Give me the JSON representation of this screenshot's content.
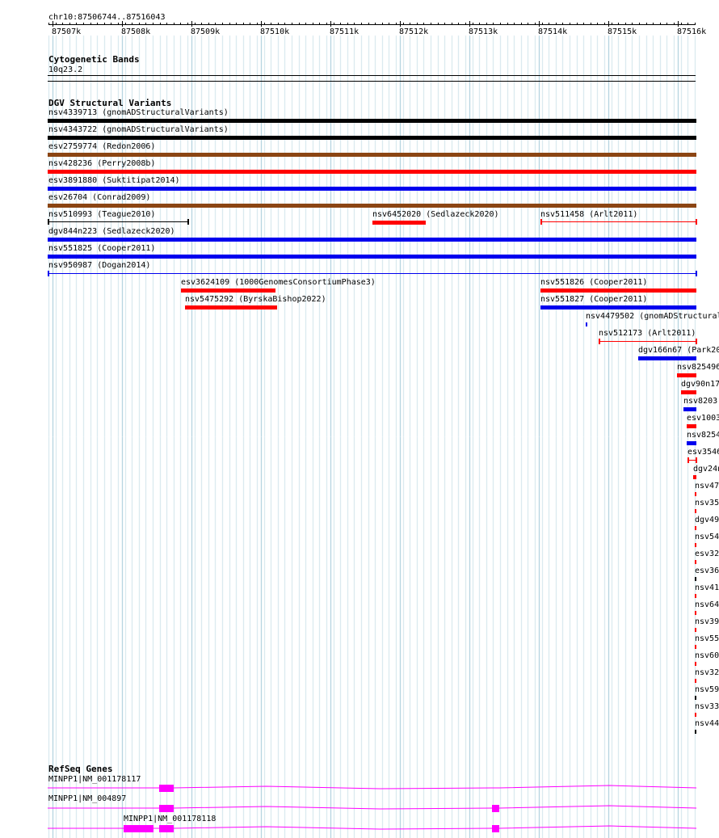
{
  "ruler": {
    "coordinates": "chr10:87506744..87516043",
    "ticks": [
      "87507k",
      "87508k",
      "87509k",
      "87510k",
      "87511k",
      "87512k",
      "87513k",
      "87514k",
      "87515k",
      "87516k"
    ]
  },
  "cytoband": {
    "title": "Cytogenetic Bands",
    "band": "10q23.2"
  },
  "dgv": {
    "title": "DGV Structural Variants",
    "features": [
      {
        "label": "nsv4339713 (gnomADStructuralVariants)",
        "color": "#000000"
      },
      {
        "label": "nsv4343722 (gnomADStructuralVariants)",
        "color": "#000000"
      },
      {
        "label": "esv2759774 (Redon2006)",
        "color": "#8B4513"
      },
      {
        "label": "nsv428236 (Perry2008b)",
        "color": "#FF0000"
      },
      {
        "label": "esv3891880 (Suktitipat2014)",
        "color": "#0000EE"
      },
      {
        "label": "esv26704 (Conrad2009)",
        "color": "#8B4513"
      },
      {
        "label": "nsv510993 (Teague2010)",
        "color": "#000000"
      },
      {
        "label": "nsv6452020 (Sedlazeck2020)",
        "color": "#FF0000"
      },
      {
        "label": "nsv511458 (Arlt2011)",
        "color": "#FF0000"
      },
      {
        "label": "dgv844n223 (Sedlazeck2020)",
        "color": "#0000EE"
      },
      {
        "label": "nsv551825 (Cooper2011)",
        "color": "#0000EE"
      },
      {
        "label": "nsv950987 (Dogan2014)",
        "color": "#0000EE"
      },
      {
        "label": "esv3624109 (1000GenomesConsortiumPhase3)",
        "color": "#FF0000"
      },
      {
        "label": "nsv551826 (Cooper2011)",
        "color": "#FF0000"
      },
      {
        "label": "nsv5475292 (ByrskaBishop2022)",
        "color": "#FF0000"
      },
      {
        "label": "nsv551827 (Cooper2011)",
        "color": "#0000EE"
      },
      {
        "label": "nsv4479502 (gnomADStructural",
        "color": "#0000EE"
      },
      {
        "label": "nsv512173 (Arlt2011)",
        "color": "#FF0000"
      },
      {
        "label": "dgv166n67 (Park20",
        "color": "#0000EE"
      },
      {
        "label": "nsv825496",
        "color": "#FF0000"
      },
      {
        "label": "dgv90n17",
        "color": "#FF0000"
      },
      {
        "label": "nsv8203",
        "color": "#0000EE"
      },
      {
        "label": "esv1003",
        "color": "#FF0000"
      },
      {
        "label": "nsv8254",
        "color": "#0000EE"
      },
      {
        "label": "esv3546",
        "color": "#FF0000"
      },
      {
        "label": "dgv24n",
        "color": "#FF0000"
      },
      {
        "label": "nsv47",
        "color": "#FF0000"
      },
      {
        "label": "nsv35",
        "color": "#FF0000"
      },
      {
        "label": "dgv49",
        "color": "#FF0000"
      },
      {
        "label": "nsv54",
        "color": "#FF0000"
      },
      {
        "label": "esv32",
        "color": "#FF0000"
      },
      {
        "label": "esv36",
        "color": "#000000"
      },
      {
        "label": "nsv41",
        "color": "#FF0000"
      },
      {
        "label": "nsv64",
        "color": "#FF0000"
      },
      {
        "label": "nsv39",
        "color": "#FF0000"
      },
      {
        "label": "nsv55",
        "color": "#FF0000"
      },
      {
        "label": "nsv60",
        "color": "#FF0000"
      },
      {
        "label": "nsv32",
        "color": "#FF0000"
      },
      {
        "label": "nsv59",
        "color": "#000000"
      },
      {
        "label": "nsv33",
        "color": "#FF0000"
      },
      {
        "label": "nsv44",
        "color": "#000000"
      }
    ]
  },
  "refseq": {
    "title": "RefSeq Genes",
    "genes": [
      {
        "label": "MINPP1|NM_001178117",
        "color": "#FF00FF"
      },
      {
        "label": "MINPP1|NM_004897",
        "color": "#FF00FF"
      },
      {
        "label": "MINPP1|NM_001178118",
        "color": "#FF00FF"
      }
    ]
  }
}
